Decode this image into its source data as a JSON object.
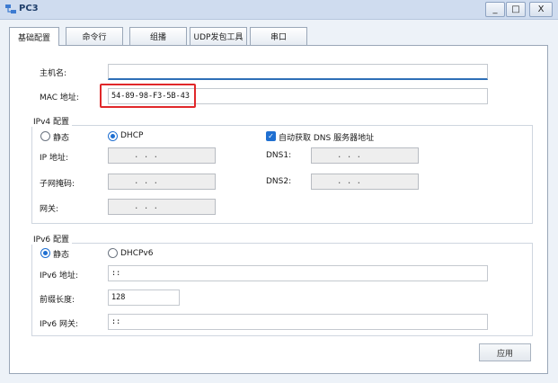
{
  "window": {
    "title": "PC3",
    "minimize_glyph": "_",
    "maximize_glyph": "□",
    "close_glyph": "X"
  },
  "tabs": [
    {
      "label": "基础配置",
      "active": true
    },
    {
      "label": "命令行",
      "active": false
    },
    {
      "label": "组播",
      "active": false
    },
    {
      "label": "UDP发包工具",
      "active": false
    },
    {
      "label": "串口",
      "active": false
    }
  ],
  "basic": {
    "hostname_label": "主机名:",
    "hostname_value": "",
    "mac_label": "MAC 地址:",
    "mac_value": "54-89-98-F3-5B-43"
  },
  "ipv4": {
    "group_label": "IPv4 配置",
    "static_label": "静态",
    "dhcp_label": "DHCP",
    "mode": "DHCP",
    "auto_dns_label": "自动获取 DNS 服务器地址",
    "auto_dns_checked": true,
    "ip_label": "IP 地址:",
    "mask_label": "子网掩码:",
    "gateway_label": "网关:",
    "dns1_label": "DNS1:",
    "dns2_label": "DNS2:",
    "ip_dots": ".     .     .",
    "mask_dots": ".     .     .",
    "gateway_dots": ".     .     .",
    "dns1_dots": ".     .     .",
    "dns2_dots": ".     .     ."
  },
  "ipv6": {
    "group_label": "IPv6 配置",
    "static_label": "静态",
    "dhcpv6_label": "DHCPv6",
    "mode": "静态",
    "address_label": "IPv6 地址:",
    "address_value": "::",
    "prefix_label": "前缀长度:",
    "prefix_value": "128",
    "gateway_label": "IPv6 网关:",
    "gateway_value": "::"
  },
  "actions": {
    "apply_label": "应用"
  },
  "colors": {
    "accent": "#1f6fd1",
    "highlight": "#e0282a",
    "titlebar": "#cfdcef"
  }
}
